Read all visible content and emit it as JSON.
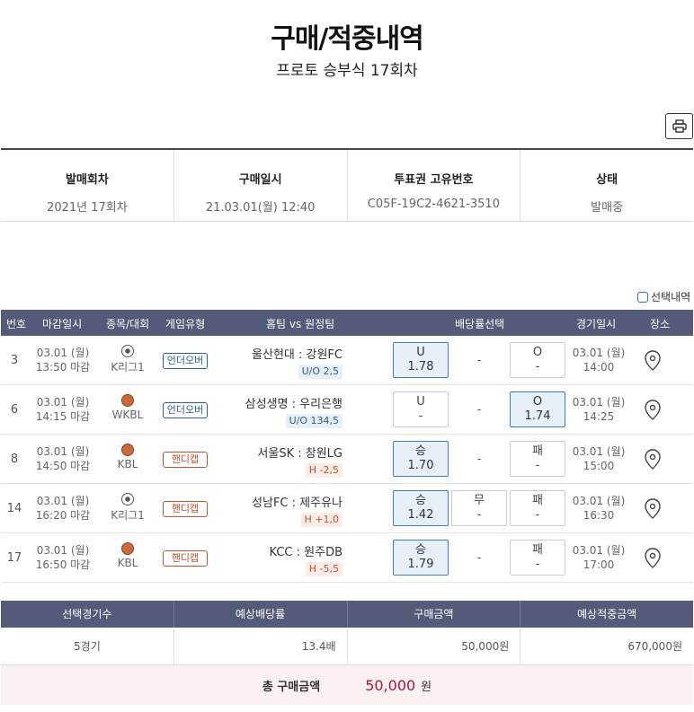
{
  "header": {
    "title": "구매/적중내역",
    "subtitle": "프로토 승부식 17회차"
  },
  "legend": "선택내역",
  "info": {
    "round_label": "발매회차",
    "round_value": "2021년 17회차",
    "buy_label": "구매일시",
    "buy_value": "21.03.01(월) 12:40",
    "ticket_label": "투표권 고유번호",
    "ticket_value": "C05F-19C2-4621-3510",
    "status_label": "상태",
    "status_value": "발매중"
  },
  "table": {
    "headers": {
      "no": "번호",
      "deadline": "마감일시",
      "sport": "종목/대회",
      "gametype": "게임유형",
      "teams": "홈팀 vs 원정팀",
      "odds": "배당률선택",
      "gamedate": "경기일시",
      "venue": "장소"
    },
    "rows": [
      {
        "no": "3",
        "deadline_date": "03.01 (월)",
        "deadline_time": "13:50 마감",
        "sport": "soccer",
        "league": "K리그1",
        "gametype": "언더오버",
        "gtype": "uo",
        "teams": "울산현대 : 강원FC",
        "tag": "U/O 2,5",
        "opt1": [
          "U",
          "1.78"
        ],
        "mid": "-",
        "opt3": [
          "O",
          "-"
        ],
        "sel": 1,
        "game_date": "03.01 (월)",
        "game_time": "14:00"
      },
      {
        "no": "6",
        "deadline_date": "03.01 (월)",
        "deadline_time": "14:15 마감",
        "sport": "basketball",
        "league": "WKBL",
        "gametype": "언더오버",
        "gtype": "uo",
        "teams": "삼성생명 : 우리은행",
        "tag": "U/O 134,5",
        "opt1": [
          "U",
          "-"
        ],
        "mid": "-",
        "opt3": [
          "O",
          "1.74"
        ],
        "sel": 3,
        "game_date": "03.01 (월)",
        "game_time": "14:25"
      },
      {
        "no": "8",
        "deadline_date": "03.01 (월)",
        "deadline_time": "14:50 마감",
        "sport": "basketball",
        "league": "KBL",
        "gametype": "핸디캡",
        "gtype": "h",
        "teams": "서울SK : 창원LG",
        "tag": "H -2,5",
        "opt1": [
          "승",
          "1.70"
        ],
        "mid": "-",
        "opt3": [
          "패",
          "-"
        ],
        "sel": 1,
        "game_date": "03.01 (월)",
        "game_time": "15:00"
      },
      {
        "no": "14",
        "deadline_date": "03.01 (월)",
        "deadline_time": "16:20 마감",
        "sport": "soccer",
        "league": "K리그1",
        "gametype": "핸디캡",
        "gtype": "h",
        "teams": "성남FC : 제주유나",
        "tag": "H +1,0",
        "opt1": [
          "승",
          "1.42"
        ],
        "mid2": [
          "무",
          "-"
        ],
        "opt3": [
          "패",
          "-"
        ],
        "sel": 1,
        "game_date": "03.01 (월)",
        "game_time": "16:30"
      },
      {
        "no": "17",
        "deadline_date": "03.01 (월)",
        "deadline_time": "16:50 마감",
        "sport": "basketball",
        "league": "KBL",
        "gametype": "핸디캡",
        "gtype": "h",
        "teams": "KCC : 원주DB",
        "tag": "H -5,5",
        "opt1": [
          "승",
          "1.79"
        ],
        "mid": "-",
        "opt3": [
          "패",
          "-"
        ],
        "sel": 1,
        "game_date": "03.01 (월)",
        "game_time": "17:00"
      }
    ]
  },
  "summary": {
    "h_count": "선택경기수",
    "h_odds": "예상배당률",
    "h_amount": "구매금액",
    "h_win": "예상적중금액",
    "count": "5경기",
    "odds": "13.4배",
    "amount": "50,000원",
    "win": "670,000원"
  },
  "total": {
    "label": "총 구매금액",
    "amount": "50,000",
    "unit": "원"
  }
}
